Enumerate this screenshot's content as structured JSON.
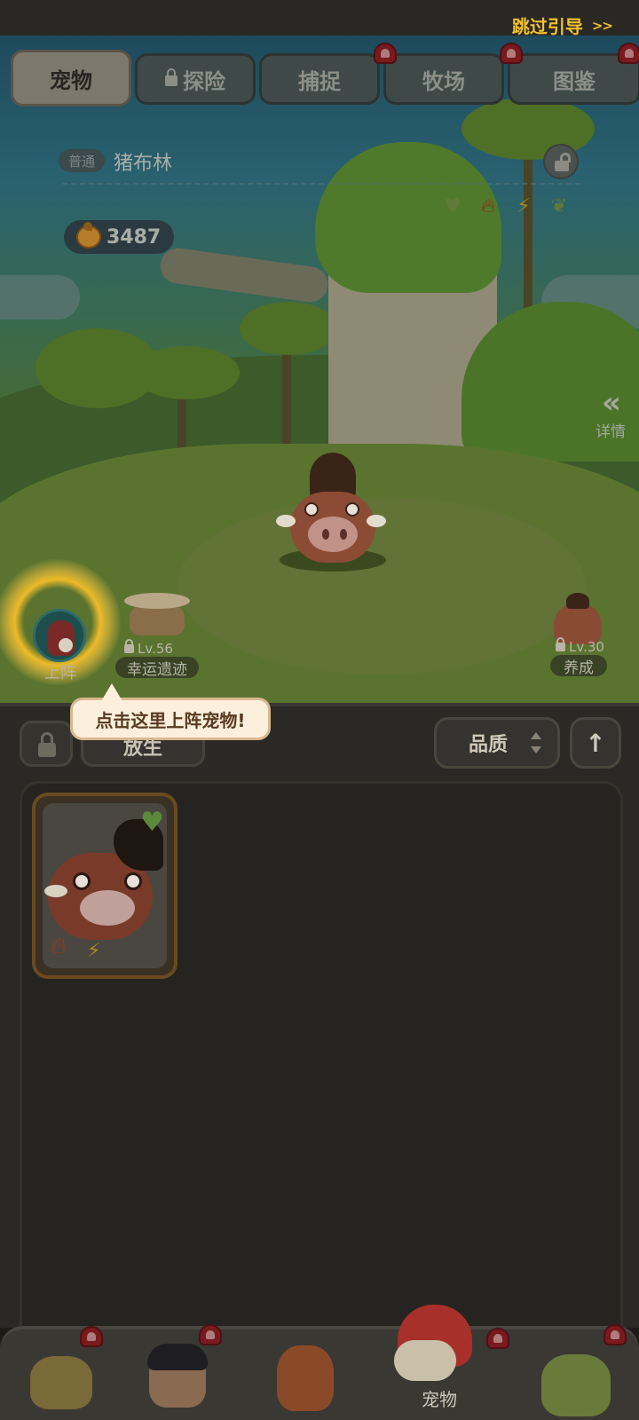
{
  "header": {
    "skip_guide": "跳过引导",
    "skip_arrows": ">>"
  },
  "tabs": [
    {
      "label": "宠物",
      "active": true,
      "locked": false,
      "badge": false
    },
    {
      "label": "探险",
      "active": false,
      "locked": true,
      "badge": false
    },
    {
      "label": "捕捉",
      "active": false,
      "locked": false,
      "badge": true
    },
    {
      "label": "牧场",
      "active": false,
      "locked": false,
      "badge": true
    },
    {
      "label": "图鉴",
      "active": false,
      "locked": false,
      "badge": true
    }
  ],
  "pet": {
    "grade": "普通",
    "name": "猪布林",
    "attributes": [
      "heart-icon",
      "fire-icon",
      "lightning-icon",
      "leaf-icon"
    ],
    "coins": "3487"
  },
  "detail": {
    "label": "详情",
    "arrow": "«"
  },
  "slots": {
    "deploy": {
      "label": "上阵"
    },
    "relic": {
      "level": "Lv.56",
      "label": "幸运遗迹"
    },
    "train": {
      "level": "Lv.30",
      "label": "养成"
    }
  },
  "tooltip": {
    "text": "点击这里上阵宠物!"
  },
  "toolbar": {
    "release_label": "放生",
    "sort_label": "品质",
    "order_arrow": "↑"
  },
  "pet_list": [
    {
      "name": "猪布林",
      "icons": [
        "heart-icon",
        "fire-icon",
        "lightning-icon"
      ]
    }
  ],
  "bottom_nav": [
    {
      "id": "caveman",
      "label": "",
      "badge": true,
      "active": false
    },
    {
      "id": "hero",
      "label": "",
      "badge": true,
      "active": false
    },
    {
      "id": "totem",
      "label": "",
      "badge": false,
      "active": false
    },
    {
      "id": "pet",
      "label": "宠物",
      "badge": true,
      "active": true
    },
    {
      "id": "tribe",
      "label": "",
      "badge": true,
      "active": false
    }
  ],
  "colors": {
    "accent_gold": "#f2c12e",
    "tooltip_bg": "#fcefdc",
    "tooltip_text": "#5b3a22",
    "badge_red": "#7a1a1e"
  }
}
